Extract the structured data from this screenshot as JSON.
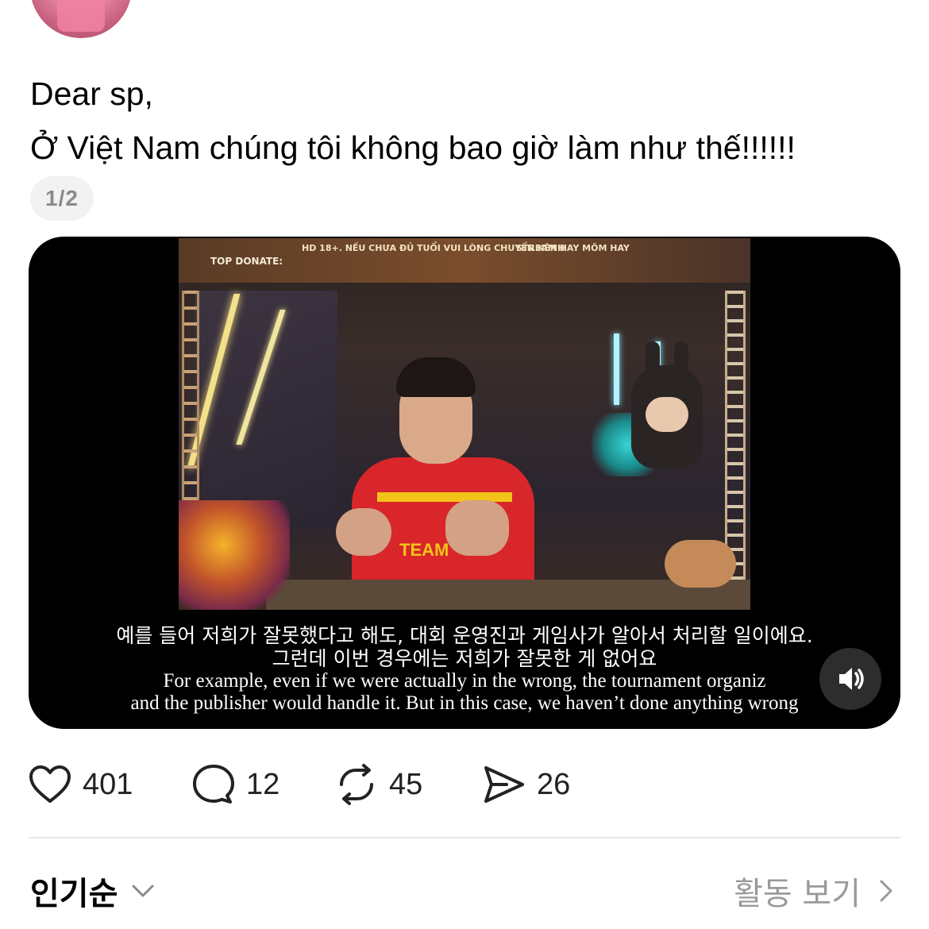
{
  "post": {
    "line1": "Dear sp,",
    "line2": "Ở Việt Nam chúng tôi không bao giờ làm như thế!!!!!!",
    "page_indicator": "1/2"
  },
  "video": {
    "overlay": {
      "top_donate": "TOP DONATE:",
      "banner_left": "HD 18+. NẾU CHƯA ĐỦ TUỔI VUI LÒNG CHUYỂN KÊNH",
      "banner_right": "STREAM HAY MÕM HAY",
      "shirt_text": "TEAM"
    },
    "subtitles": {
      "ko_line1": "예를 들어 저희가 잘못했다고 해도, 대회 운영진과 게임사가 알아서 처리할 일이에요.",
      "ko_line2": "그런데 이번 경우에는 저희가 잘못한 게 없어요",
      "en_line1": "For example, even if we were actually in the wrong, the tournament organiz",
      "en_line2": "and the publisher would handle it. But in this case, we haven’t done anything wrong"
    },
    "mute_icon": "speaker-icon"
  },
  "actions": {
    "like_count": "401",
    "reply_count": "12",
    "repost_count": "45",
    "share_count": "26"
  },
  "footer": {
    "sort_label": "인기순",
    "activity_label": "활동 보기"
  }
}
